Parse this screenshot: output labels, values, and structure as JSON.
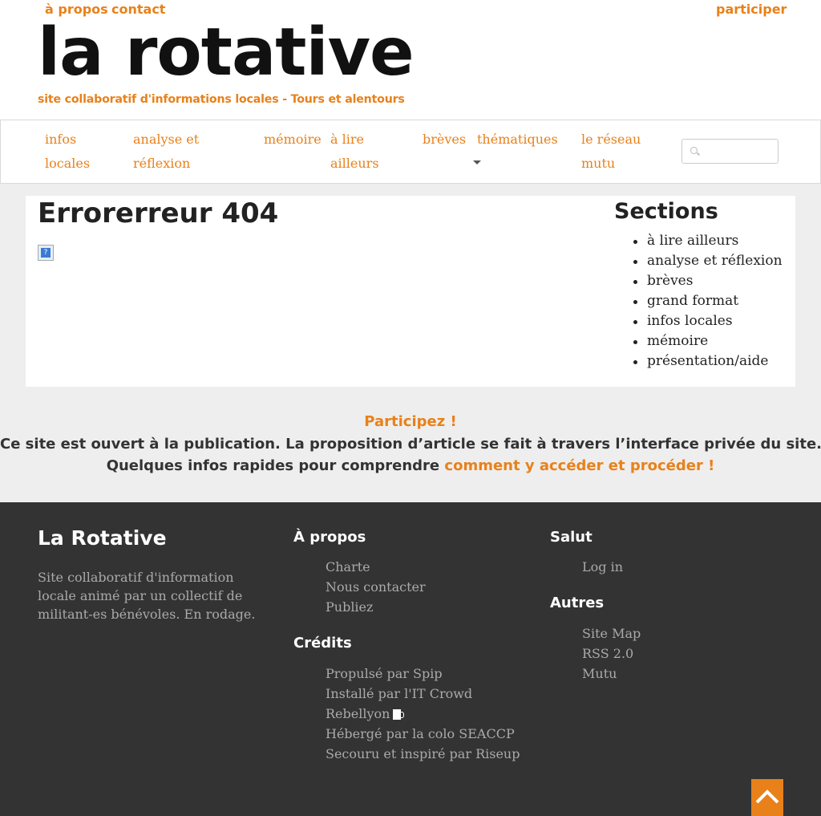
{
  "topbar": {
    "links": [
      "à propos",
      "contact"
    ],
    "participate": "participer"
  },
  "logo": {
    "title": "la rotative",
    "subtitle": "site collaboratif d'informations locales - Tours et alentours"
  },
  "nav": {
    "items": [
      "infos\nlocales",
      "analyse et\nréflexion",
      "mémoire",
      "à lire\nailleurs",
      "brèves",
      "thématiques",
      "le réseau\nmutu"
    ],
    "search_icon": "search-icon"
  },
  "main": {
    "title": "Errorerreur 404",
    "broken_image_icon": "broken-image-icon",
    "sections_title": "Sections",
    "sections": [
      "à lire ailleurs",
      "analyse et réflexion",
      "brèves",
      "grand format",
      "infos locales",
      "mémoire",
      "présentation/aide"
    ]
  },
  "participate": {
    "title": "Participez !",
    "line1": "Ce site est ouvert à la publication. La proposition d’article se fait à travers l’interface privée du site.",
    "line2_prefix": "Quelques infos rapides pour comprendre ",
    "line2_link": "comment y accéder et procéder !"
  },
  "footer": {
    "brand": "La Rotative",
    "description": "Site collaboratif d'information locale animé par un collectif de militant-es bénévoles. En rodage.",
    "apropos_title": "À propos",
    "apropos_links": [
      "Charte",
      "Nous contacter",
      "Publiez"
    ],
    "credits_title": "Crédits",
    "credits_links": [
      "Propulsé par Spip",
      "Installé par l'IT Crowd",
      "Rebellyon",
      "Hébergé par la colo SEACCP",
      "Secouru et inspiré par Riseup"
    ],
    "salut_title": "Salut",
    "salut_links": [
      "Log in"
    ],
    "autres_title": "Autres",
    "autres_links": [
      "Site Map",
      "RSS 2.0",
      "Mutu"
    ],
    "mug_icon": "mug-icon",
    "back_to_top_icon": "chevron-up-icon"
  },
  "colors": {
    "accent": "#e8811a",
    "footer_bg": "#333333",
    "page_bg": "#eeeeee"
  }
}
